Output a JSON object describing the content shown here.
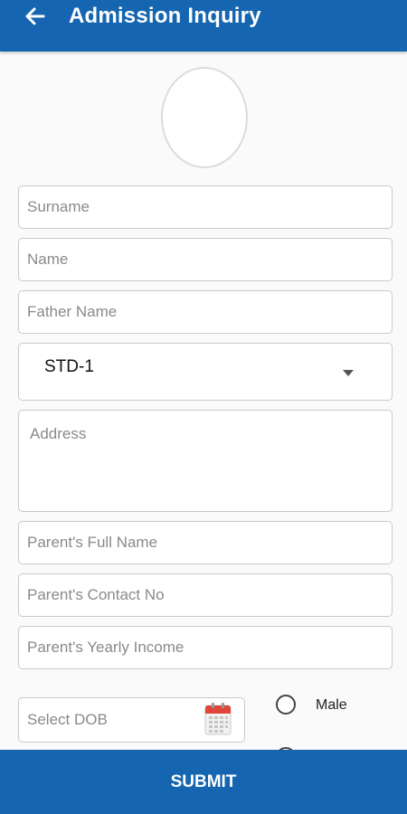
{
  "header": {
    "title": "Admission Inquiry",
    "back_icon": "arrow-left-icon",
    "color": "#1565b0"
  },
  "profile": {
    "avatar_icon": "profile-photo-placeholder"
  },
  "form": {
    "surname_placeholder": "Surname",
    "name_placeholder": "Name",
    "father_name_placeholder": "Father Name",
    "standard": {
      "selected": "STD-1",
      "icon": "dropdown-caret-icon"
    },
    "address_placeholder": "Address",
    "parent_full_name_placeholder": "Parent's Full Name",
    "parent_contact_placeholder": "Parent's Contact No",
    "parent_income_placeholder": "Parent's Yearly Income",
    "dob_placeholder": "Select DOB",
    "dob_icon": "calendar-icon",
    "gender": {
      "options": [
        "Male"
      ],
      "selected": null
    }
  },
  "footer": {
    "submit_label": "SUBMIT"
  }
}
